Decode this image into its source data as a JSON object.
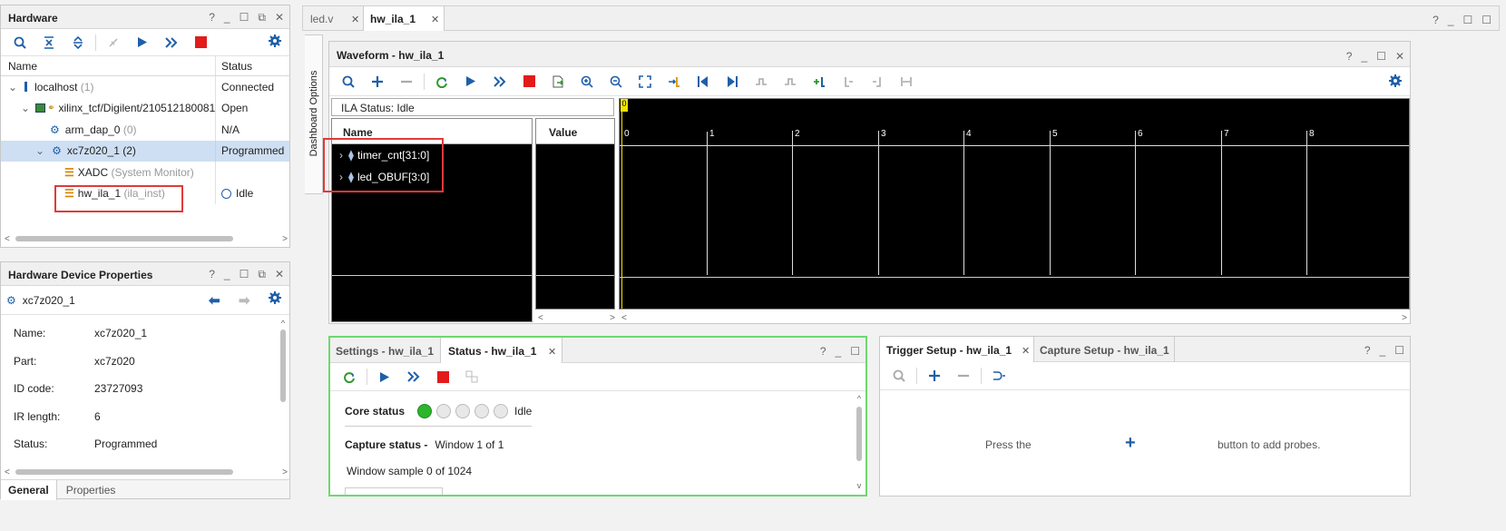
{
  "hardware": {
    "title": "Hardware",
    "col_name": "Name",
    "col_status": "Status",
    "rows": [
      {
        "name": "localhost",
        "suffix": "(1)",
        "status": "Connected"
      },
      {
        "name": "xilinx_tcf/Digilent/210512180081",
        "suffix": "",
        "status": "Open"
      },
      {
        "name": "arm_dap_0",
        "suffix": "(0)",
        "status": "N/A"
      },
      {
        "name": "xc7z020_1",
        "suffix": "(2)",
        "status": "Programmed"
      },
      {
        "name": "XADC",
        "suffix": "(System Monitor)",
        "status": ""
      },
      {
        "name": "hw_ila_1",
        "suffix": "(ila_inst)",
        "status": "Idle"
      }
    ]
  },
  "props": {
    "title": "Hardware Device Properties",
    "device": "xc7z020_1",
    "rows": [
      {
        "k": "Name:",
        "v": "xc7z020_1"
      },
      {
        "k": "Part:",
        "v": "xc7z020"
      },
      {
        "k": "ID code:",
        "v": "23727093"
      },
      {
        "k": "IR length:",
        "v": "6"
      },
      {
        "k": "Status:",
        "v": "Programmed"
      }
    ],
    "tabs": [
      "General",
      "Properties"
    ]
  },
  "editor_tabs": [
    "led.v",
    "hw_ila_1"
  ],
  "dashboard_label": "Dashboard Options",
  "waveform": {
    "title": "Waveform - hw_ila_1",
    "ila_status": "ILA Status: Idle",
    "col_name": "Name",
    "col_value": "Value",
    "signals": [
      "timer_cnt[31:0]",
      "led_OBUF[3:0]"
    ],
    "marker": "0",
    "ticks": [
      "0",
      "1",
      "2",
      "3",
      "4",
      "5",
      "6",
      "7",
      "8"
    ]
  },
  "status_panel": {
    "tabs": [
      "Settings - hw_ila_1",
      "Status - hw_ila_1"
    ],
    "core_status_label": "Core status",
    "core_status_value": "Idle",
    "capture_status_label": "Capture status -",
    "capture_status_value": "Window 1 of 1",
    "window_sample": "Window sample 0 of 1024"
  },
  "trigger_panel": {
    "tabs": [
      "Trigger Setup - hw_ila_1",
      "Capture Setup - hw_ila_1"
    ],
    "hint_left": "Press the",
    "hint_right": "button to add probes."
  },
  "colors": {
    "accent_blue": "#1f5fa8",
    "stop_red": "#e21b1b",
    "status_green": "#2db52d",
    "highlight_green": "#6fd86f",
    "annotation_red": "#e03a3a"
  }
}
